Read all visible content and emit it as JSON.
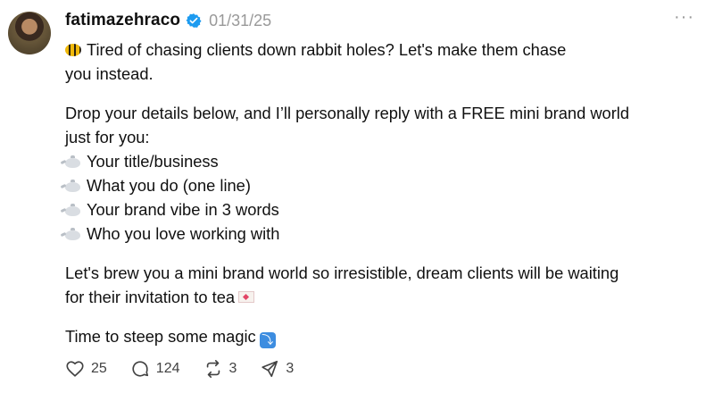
{
  "post": {
    "username": "fatimazehraco",
    "date": "01/31/25",
    "more_label": "···",
    "lines": [
      "Tired of chasing clients down rabbit holes? Let's make them chase",
      "you instead.",
      "Drop your details below, and I’ll personally reply with a FREE mini brand world",
      "just for you:",
      "Your title/business",
      "What you do (one line)",
      "Your brand vibe in 3 words",
      "Who you love working with",
      "Let's brew you a mini brand world so irresistible, dream clients will be waiting",
      "for their invitation to tea",
      "Time to steep some magic"
    ],
    "icons": {
      "avatar": "profile-photo",
      "verified": "verified-badge-icon",
      "line1": "bee-emoji",
      "bullets": "teapot-emoji",
      "tea_line": "love-letter-emoji",
      "magic_line": "down-arrow-emoji"
    }
  },
  "actions": {
    "likes": "25",
    "comments": "124",
    "reposts": "3",
    "shares": "3"
  },
  "colors": {
    "text": "#101010",
    "muted": "#999999",
    "verified": "#1d9bf0"
  }
}
